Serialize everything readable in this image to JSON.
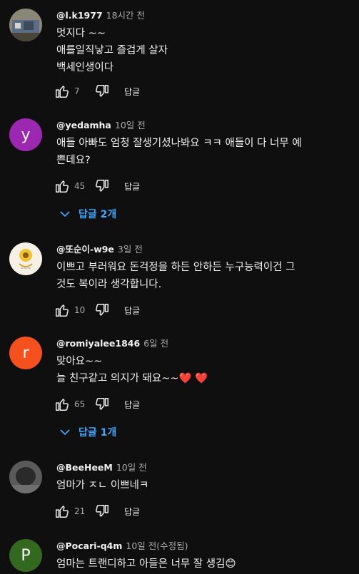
{
  "comments": [
    {
      "handle": "@l.k1977",
      "time": "18시간 전",
      "lines": [
        "멋지다 ~~",
        "애를일직낳고  즐겁게 살자",
        "백세인생이다"
      ],
      "likes": "7",
      "reply_label": "답글",
      "avatar_letter": "",
      "avatar_color": "#7a7a6a"
    },
    {
      "handle": "@yedamha",
      "time": "10일 전",
      "lines": [
        "애들 아빠도 엄청 잘생기셨나봐요 ㅋㅋ 애들이 다 너무 예",
        "쁜데요?"
      ],
      "likes": "45",
      "reply_label": "답글",
      "avatar_letter": "y",
      "avatar_color": "#9c27b0",
      "replies_label": "답글 2개"
    },
    {
      "handle": "@또순이-w9e",
      "time": "3일 전",
      "lines": [
        "이쁘고 부러워요 돈걱정을 하든 안하든 누구능력이건 그",
        "것도 복이라 생각합니다."
      ],
      "likes": "10",
      "reply_label": "답글",
      "avatar_letter": "",
      "avatar_color": "#f3efe2"
    },
    {
      "handle": "@romiyalee1846",
      "time": "6일 전",
      "lines": [
        "맞아요~~",
        "늘 친구같고 의지가 돼요~~"
      ],
      "hearts": "❤️ ❤️",
      "likes": "65",
      "reply_label": "답글",
      "avatar_letter": "r",
      "avatar_color": "#f4511e",
      "replies_label": "답글 1개"
    },
    {
      "handle": "@BeeHeeM",
      "time": "10일 전",
      "lines": [
        "엄마가 ㅈㄴ 이쁘네ㅋ"
      ],
      "likes": "21",
      "reply_label": "답글",
      "avatar_letter": "",
      "avatar_color": "#3a3a3a"
    },
    {
      "handle": "@Pocari-q4m",
      "time": "10일 전(수정됨)",
      "lines": [
        "엄마는 트랜디하고 아들은 너무 잘 생김"
      ],
      "emoji": "😊",
      "avatar_letter": "P",
      "avatar_color": "#33691e"
    }
  ],
  "colors": {
    "background": "#0f0f0f",
    "text": "#f1f1f1",
    "secondary": "#aaaaaa",
    "link": "#3ea6ff"
  }
}
